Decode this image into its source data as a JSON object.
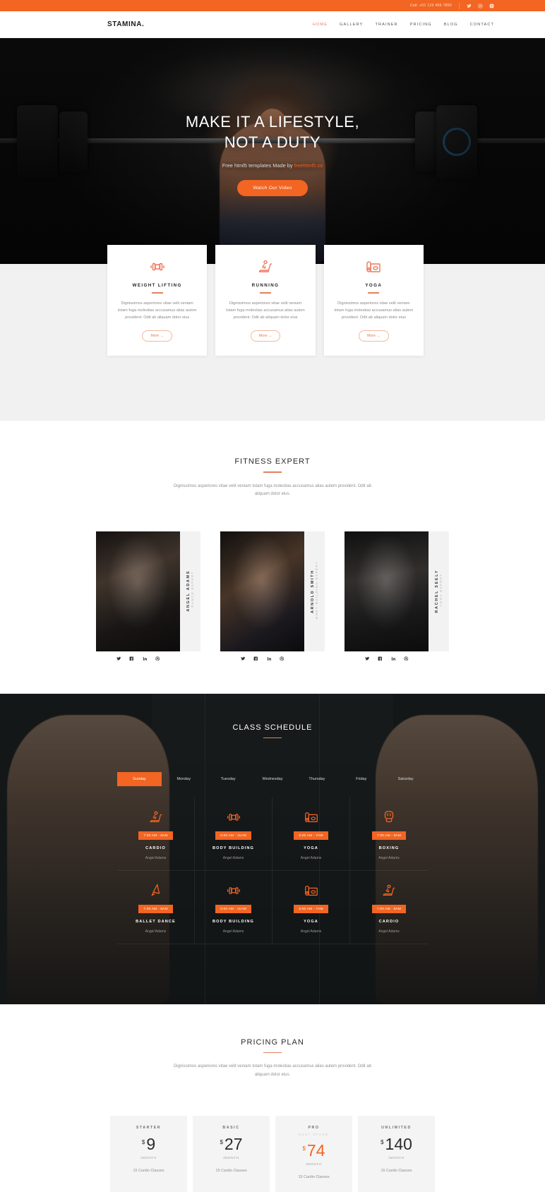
{
  "topbar": {
    "phone": "Call: +01 123 456 7890",
    "socials": [
      "twitter-icon",
      "dribbble-icon",
      "instagram-icon"
    ]
  },
  "nav": {
    "logo": "STAMINA.",
    "items": [
      {
        "label": "HOME",
        "active": true
      },
      {
        "label": "GALLERY",
        "active": false
      },
      {
        "label": "TRAINER",
        "active": false
      },
      {
        "label": "PRICING",
        "active": false
      },
      {
        "label": "BLOG",
        "active": false
      },
      {
        "label": "CONTACT",
        "active": false
      }
    ]
  },
  "hero": {
    "title_line1": "MAKE IT A LIFESTYLE,",
    "title_line2": "NOT A DUTY",
    "subtitle_prefix": "Free html5 templates Made by ",
    "subtitle_link": "freehtml5.co",
    "button": "Watch Our Video"
  },
  "services": {
    "cards": [
      {
        "icon": "dumbbell-icon",
        "title": "WEIGHT LIFTING",
        "text": "Dignissimos asperiores vitae velit veniam totam fuga molestias accusamus alias autem provident. Odit ab aliquam dolor eius",
        "more": "More →"
      },
      {
        "icon": "treadmill-icon",
        "title": "RUNNING",
        "text": "Dignissimos asperiores vitae velit veniam totam fuga molestias accusamus alias autem provident. Odit ab aliquam dolor eius",
        "more": "More →"
      },
      {
        "icon": "yoga-mat-icon",
        "title": "YOGA",
        "text": "Dignissimos asperiores vitae velit veniam totam fuga molestias accusamus alias autem provident. Odit ab aliquam dolor eius",
        "more": "More →"
      }
    ]
  },
  "experts": {
    "title": "FITNESS EXPERT",
    "subtitle": "Dignissimos asperiores vitae velit veniam totam fuga molestias accusamus alias autem provident. Odit ab aliquam dolor eius.",
    "trainers": [
      {
        "name": "ANGEL ADAMS",
        "role": "DANCE EXPERT"
      },
      {
        "name": "ARNOLD SMITH",
        "role": "BODY BUILDING EXPERT"
      },
      {
        "name": "RACHEL SEELY",
        "role": "YOGA EXPERT"
      }
    ],
    "social_icons": [
      "twitter-icon",
      "facebook-icon",
      "linkedin-icon",
      "dribbble-icon"
    ]
  },
  "schedule": {
    "title": "CLASS SCHEDULE",
    "days": [
      {
        "label": "Sunday",
        "active": true
      },
      {
        "label": "Monday",
        "active": false
      },
      {
        "label": "Tuesday",
        "active": false
      },
      {
        "label": "Wednesday",
        "active": false
      },
      {
        "label": "Thursday",
        "active": false
      },
      {
        "label": "Friday",
        "active": false
      },
      {
        "label": "Saturday",
        "active": false
      }
    ],
    "classes": [
      {
        "icon": "treadmill-icon",
        "time": "7:00 AM - 8AM",
        "name": "CARDIO",
        "coach": "Angel Adams"
      },
      {
        "icon": "dumbbell-icon",
        "time": "9:00 AM - 11AM",
        "name": "BODY BUILDING",
        "coach": "Angel Adams"
      },
      {
        "icon": "yoga-mat-icon",
        "time": "6:00 AM - 7AM",
        "name": "YOGA",
        "coach": "Angel Adams"
      },
      {
        "icon": "boxing-icon",
        "time": "7:00 AM - 8AM",
        "name": "BOXING",
        "coach": "Angel Adams"
      },
      {
        "icon": "ballet-icon",
        "time": "7:00 AM - 8AM",
        "name": "BALLET DANCE",
        "coach": "Angel Adams"
      },
      {
        "icon": "dumbbell-icon",
        "time": "9:00 AM - 11AM",
        "name": "BODY BUILDING",
        "coach": "Angel Adams"
      },
      {
        "icon": "yoga-mat-icon",
        "time": "6:00 AM - 7AM",
        "name": "YOGA",
        "coach": "Angel Adams"
      },
      {
        "icon": "treadmill-icon",
        "time": "7:00 AM - 8AM",
        "name": "CARDIO",
        "coach": "Angel Adams"
      }
    ]
  },
  "pricing": {
    "title": "PRICING PLAN",
    "subtitle": "Dignissimos asperiores vitae velit veniam totam fuga molestias accusamus alias autem provident. Odit ab aliquam dolor eius.",
    "plans": [
      {
        "name": "STARTER",
        "badge": "",
        "currency": "$",
        "value": "9",
        "period": "/MONTH",
        "feature": "15 Cardio Classes",
        "featured": false
      },
      {
        "name": "BASIC",
        "badge": "",
        "currency": "$",
        "value": "27",
        "period": "/MONTH",
        "feature": "15 Cardio Classes",
        "featured": false
      },
      {
        "name": "PRO",
        "badge": "BEST OFFER",
        "currency": "$",
        "value": "74",
        "period": "/MONTH",
        "feature": "15 Cardio Classes",
        "featured": true
      },
      {
        "name": "UNLIMITED",
        "badge": "",
        "currency": "$",
        "value": "140",
        "period": "/MONTH",
        "feature": "15 Cardio Classes",
        "featured": false
      }
    ]
  },
  "colors": {
    "accent": "#f26522",
    "accent_light": "#f0775a",
    "dark": "#1a1d1f"
  }
}
